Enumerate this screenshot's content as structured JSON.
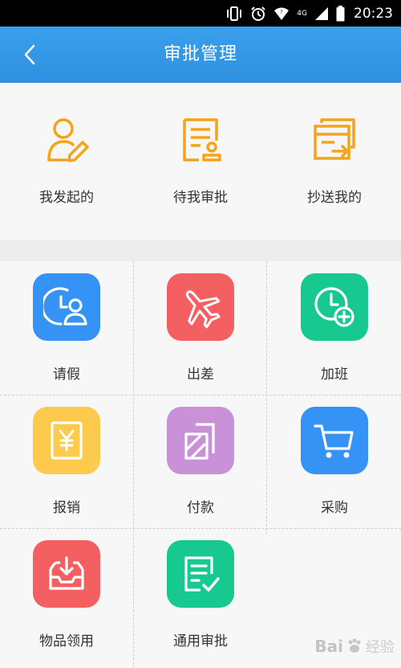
{
  "status_bar": {
    "time": "20:23",
    "network_label": "4G"
  },
  "header": {
    "title": "审批管理"
  },
  "top_shortcuts": [
    {
      "label": "我发起的",
      "icon": "user-edit-icon"
    },
    {
      "label": "待我审批",
      "icon": "document-stamp-icon"
    },
    {
      "label": "抄送我的",
      "icon": "cc-forward-icon"
    }
  ],
  "grid_items": [
    {
      "label": "请假",
      "icon": "clock-person-icon",
      "color": "#3593f5"
    },
    {
      "label": "出差",
      "icon": "airplane-icon",
      "color": "#f46061"
    },
    {
      "label": "加班",
      "icon": "clock-plus-icon",
      "color": "#17c98e"
    },
    {
      "label": "报销",
      "icon": "yen-receipt-icon",
      "color": "#fdca4d"
    },
    {
      "label": "付款",
      "icon": "payment-card-icon",
      "color": "#c992d8"
    },
    {
      "label": "采购",
      "icon": "shopping-cart-icon",
      "color": "#3593f5"
    },
    {
      "label": "物品领用",
      "icon": "inbox-tray-icon",
      "color": "#f46061"
    },
    {
      "label": "通用审批",
      "icon": "document-check-icon",
      "color": "#17c98e"
    }
  ],
  "accent_color": "#3196e8",
  "shortcut_icon_color": "#f5a31b",
  "watermark": {
    "brand": "Bai",
    "suffix": "经验"
  }
}
